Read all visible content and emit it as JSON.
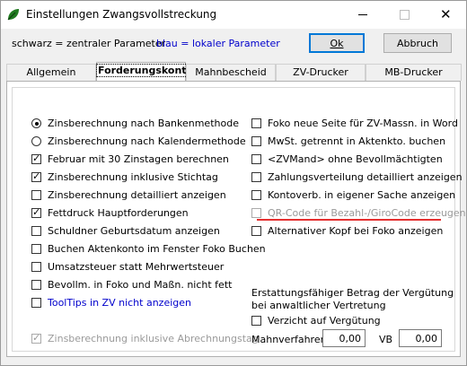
{
  "window": {
    "title": "Einstellungen Zwangsvollstreckung"
  },
  "legend": {
    "black": "schwarz = zentraler Parameter",
    "blue": "blau = lokaler Parameter"
  },
  "buttons": {
    "ok": "Ok",
    "cancel": "Abbruch"
  },
  "tabs": [
    {
      "label": "Allgemein",
      "active": false
    },
    {
      "label": "Forderungskonto",
      "active": true
    },
    {
      "label": "Mahnbescheid",
      "active": false
    },
    {
      "label": "ZV-Drucker",
      "active": false
    },
    {
      "label": "MB-Drucker",
      "active": false
    }
  ],
  "left_options": [
    {
      "label": "Zinsberechnung nach Bankenmethode",
      "type": "radio",
      "checked": true
    },
    {
      "label": "Zinsberechnung nach Kalendermethode",
      "type": "radio",
      "checked": false
    },
    {
      "label": "Februar mit 30 Zinstagen berechnen",
      "type": "checkbox",
      "checked": true
    },
    {
      "label": "Zinsberechnung inklusive Stichtag",
      "type": "checkbox",
      "checked": true
    },
    {
      "label": "Zinsberechnung detailliert anzeigen",
      "type": "checkbox",
      "checked": false
    },
    {
      "label": "Fettdruck Hauptforderungen",
      "type": "checkbox",
      "checked": true
    },
    {
      "label": "Schuldner Geburtsdatum anzeigen",
      "type": "checkbox",
      "checked": false
    },
    {
      "label": "Buchen Aktenkonto im Fenster Foko Buchen",
      "type": "checkbox",
      "checked": false
    },
    {
      "label": "Umsatzsteuer statt Mehrwertsteuer",
      "type": "checkbox",
      "checked": false
    },
    {
      "label": "Bevollm. in Foko und Maßn. nicht fett",
      "type": "checkbox",
      "checked": false
    },
    {
      "label": "ToolTips in ZV nicht anzeigen",
      "type": "checkbox",
      "checked": false,
      "local": true
    },
    {
      "label": "Zinsberechnung inklusive Abrechnungstag",
      "type": "checkbox",
      "checked": true,
      "disabled": true
    }
  ],
  "right_options": [
    {
      "label": "Foko neue Seite für ZV-Massn. in Word",
      "checked": false
    },
    {
      "label": "MwSt. getrennt in Aktenkto. buchen",
      "checked": false
    },
    {
      "label": "<ZVMand> ohne Bevollmächtigten",
      "checked": false
    },
    {
      "label": "Zahlungsverteilung detailliert anzeigen",
      "checked": false
    },
    {
      "label": "Kontoverb. in eigener Sache anzeigen",
      "checked": false
    },
    {
      "label": "QR-Code für Bezahl-/GiroCode erzeugen",
      "checked": false,
      "disabled": true
    },
    {
      "label": "Alternativer Kopf bei Foko anzeigen",
      "checked": false
    }
  ],
  "refund": {
    "heading_line1": "Erstattungsfähiger Betrag der Vergütung",
    "heading_line2": "bei anwaltlicher Vertretung",
    "waiver_label": "Verzicht auf Vergütung",
    "dunning_label": "Mahnverfahren",
    "dunning_value": "0,00",
    "vb_label": "VB",
    "vb_value": "0,00"
  },
  "colors": {
    "local_param": "#0000cc",
    "highlight_underline": "#e53030"
  }
}
